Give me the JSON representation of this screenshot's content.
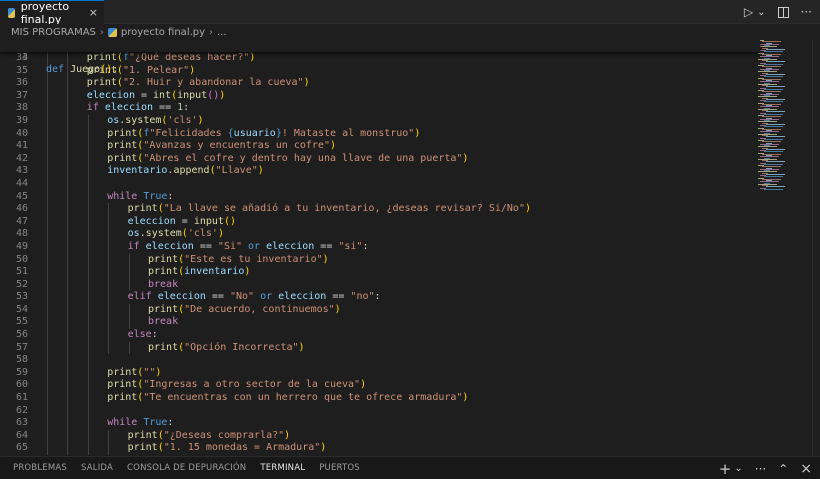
{
  "tab": {
    "title": "proyecto final.py",
    "close": "×"
  },
  "tab_actions": {
    "run": "▷",
    "run_menu": "⌄",
    "more": "···"
  },
  "breadcrumb": {
    "folder": "MIS PROGRAMAS",
    "sep1": "›",
    "file": "proyecto final.py",
    "sep2": "›",
    "rest": "..."
  },
  "sticky": {
    "number": "3",
    "code": [
      [
        "kb",
        "def "
      ],
      [
        "fn",
        "Juego"
      ],
      [
        "br1",
        "():"
      ]
    ]
  },
  "lines": [
    {
      "n": "34",
      "indent": 2,
      "code": [
        [
          "fn",
          "print"
        ],
        [
          "br1",
          "("
        ],
        [
          "kb",
          "f"
        ],
        [
          "st",
          "\"¿Qué deseas hacer?\""
        ],
        [
          "br1",
          ")"
        ]
      ]
    },
    {
      "n": "35",
      "indent": 2,
      "code": [
        [
          "fn",
          "print"
        ],
        [
          "br1",
          "("
        ],
        [
          "st",
          "\"1. Pelear\""
        ],
        [
          "br1",
          ")"
        ]
      ]
    },
    {
      "n": "36",
      "indent": 2,
      "code": [
        [
          "fn",
          "print"
        ],
        [
          "br1",
          "("
        ],
        [
          "st",
          "\"2. Huir y abandonar la cueva\""
        ],
        [
          "br1",
          ")"
        ]
      ]
    },
    {
      "n": "37",
      "indent": 2,
      "code": [
        [
          "vr",
          "eleccion"
        ],
        [
          "tx",
          " = "
        ],
        [
          "fn",
          "int"
        ],
        [
          "br1",
          "("
        ],
        [
          "fn",
          "input"
        ],
        [
          "br2",
          "()"
        ],
        [
          "br1",
          ")"
        ]
      ]
    },
    {
      "n": "38",
      "indent": 2,
      "code": [
        [
          "kw",
          "if "
        ],
        [
          "vr",
          "eleccion"
        ],
        [
          "tx",
          " == "
        ],
        [
          "nm",
          "1"
        ],
        [
          "tx",
          ":"
        ]
      ]
    },
    {
      "n": "39",
      "indent": 3,
      "code": [
        [
          "vr",
          "os"
        ],
        [
          "tx",
          "."
        ],
        [
          "fn",
          "system"
        ],
        [
          "br1",
          "("
        ],
        [
          "st",
          "'cls'"
        ],
        [
          "br1",
          ")"
        ]
      ]
    },
    {
      "n": "40",
      "indent": 3,
      "code": [
        [
          "fn",
          "print"
        ],
        [
          "br1",
          "("
        ],
        [
          "kb",
          "f"
        ],
        [
          "st",
          "\"Felicidades "
        ],
        [
          "kb",
          "{"
        ],
        [
          "vr",
          "usuario"
        ],
        [
          "kb",
          "}"
        ],
        [
          "st",
          "! Mataste al monstruo\""
        ],
        [
          "br1",
          ")"
        ]
      ]
    },
    {
      "n": "41",
      "indent": 3,
      "code": [
        [
          "fn",
          "print"
        ],
        [
          "br1",
          "("
        ],
        [
          "st",
          "\"Avanzas y encuentras un cofre\""
        ],
        [
          "br1",
          ")"
        ]
      ]
    },
    {
      "n": "42",
      "indent": 3,
      "code": [
        [
          "fn",
          "print"
        ],
        [
          "br1",
          "("
        ],
        [
          "st",
          "\"Abres el cofre y dentro hay una llave de una puerta\""
        ],
        [
          "br1",
          ")"
        ]
      ]
    },
    {
      "n": "43",
      "indent": 3,
      "code": [
        [
          "vr",
          "inventario"
        ],
        [
          "tx",
          "."
        ],
        [
          "fn",
          "append"
        ],
        [
          "br1",
          "("
        ],
        [
          "st",
          "\"Llave\""
        ],
        [
          "br1",
          ")"
        ]
      ]
    },
    {
      "n": "44",
      "indent": 3,
      "code": []
    },
    {
      "n": "45",
      "indent": 3,
      "code": [
        [
          "kw",
          "while "
        ],
        [
          "kb",
          "True"
        ],
        [
          "tx",
          ":"
        ]
      ]
    },
    {
      "n": "46",
      "indent": 4,
      "code": [
        [
          "fn",
          "print"
        ],
        [
          "br1",
          "("
        ],
        [
          "st",
          "\"La llave se añadió a tu inventario, ¿deseas revisar? Si/No\""
        ],
        [
          "br1",
          ")"
        ]
      ]
    },
    {
      "n": "47",
      "indent": 4,
      "code": [
        [
          "vr",
          "eleccion"
        ],
        [
          "tx",
          " = "
        ],
        [
          "fn",
          "input"
        ],
        [
          "br1",
          "()"
        ]
      ]
    },
    {
      "n": "48",
      "indent": 4,
      "code": [
        [
          "vr",
          "os"
        ],
        [
          "tx",
          "."
        ],
        [
          "fn",
          "system"
        ],
        [
          "br1",
          "("
        ],
        [
          "st",
          "'cls'"
        ],
        [
          "br1",
          ")"
        ]
      ]
    },
    {
      "n": "49",
      "indent": 4,
      "code": [
        [
          "kw",
          "if "
        ],
        [
          "vr",
          "eleccion"
        ],
        [
          "tx",
          " == "
        ],
        [
          "st",
          "\"Si\""
        ],
        [
          "kb",
          " or "
        ],
        [
          "vr",
          "eleccion"
        ],
        [
          "tx",
          " == "
        ],
        [
          "st",
          "\"si\""
        ],
        [
          "tx",
          ":"
        ]
      ]
    },
    {
      "n": "50",
      "indent": 5,
      "code": [
        [
          "fn",
          "print"
        ],
        [
          "br1",
          "("
        ],
        [
          "st",
          "\"Este es tu inventario\""
        ],
        [
          "br1",
          ")"
        ]
      ]
    },
    {
      "n": "51",
      "indent": 5,
      "code": [
        [
          "fn",
          "print"
        ],
        [
          "br1",
          "("
        ],
        [
          "vr",
          "inventario"
        ],
        [
          "br1",
          ")"
        ]
      ]
    },
    {
      "n": "52",
      "indent": 5,
      "code": [
        [
          "kw",
          "break"
        ]
      ]
    },
    {
      "n": "53",
      "indent": 4,
      "code": [
        [
          "kw",
          "elif "
        ],
        [
          "vr",
          "eleccion"
        ],
        [
          "tx",
          " == "
        ],
        [
          "st",
          "\"No\""
        ],
        [
          "kb",
          " or "
        ],
        [
          "vr",
          "eleccion"
        ],
        [
          "tx",
          " == "
        ],
        [
          "st",
          "\"no\""
        ],
        [
          "tx",
          ":"
        ]
      ]
    },
    {
      "n": "54",
      "indent": 5,
      "code": [
        [
          "fn",
          "print"
        ],
        [
          "br1",
          "("
        ],
        [
          "st",
          "\"De acuerdo, continuemos\""
        ],
        [
          "br1",
          ")"
        ]
      ]
    },
    {
      "n": "55",
      "indent": 5,
      "code": [
        [
          "kw",
          "break"
        ]
      ]
    },
    {
      "n": "56",
      "indent": 4,
      "code": [
        [
          "kw",
          "else"
        ],
        [
          "tx",
          ":"
        ]
      ]
    },
    {
      "n": "57",
      "indent": 5,
      "code": [
        [
          "fn",
          "print"
        ],
        [
          "br1",
          "("
        ],
        [
          "st",
          "\"Opción Incorrecta\""
        ],
        [
          "br1",
          ")"
        ]
      ]
    },
    {
      "n": "58",
      "indent": 3,
      "code": []
    },
    {
      "n": "59",
      "indent": 3,
      "code": [
        [
          "fn",
          "print"
        ],
        [
          "br1",
          "("
        ],
        [
          "st",
          "\"\""
        ],
        [
          "br1",
          ")"
        ]
      ]
    },
    {
      "n": "60",
      "indent": 3,
      "code": [
        [
          "fn",
          "print"
        ],
        [
          "br1",
          "("
        ],
        [
          "st",
          "\"Ingresas a otro sector de la cueva\""
        ],
        [
          "br1",
          ")"
        ]
      ]
    },
    {
      "n": "61",
      "indent": 3,
      "code": [
        [
          "fn",
          "print"
        ],
        [
          "br1",
          "("
        ],
        [
          "st",
          "\"Te encuentras con un herrero que te ofrece armadura\""
        ],
        [
          "br1",
          ")"
        ]
      ]
    },
    {
      "n": "62",
      "indent": 3,
      "code": []
    },
    {
      "n": "63",
      "indent": 3,
      "code": [
        [
          "kw",
          "while "
        ],
        [
          "kb",
          "True"
        ],
        [
          "tx",
          ":"
        ]
      ]
    },
    {
      "n": "64",
      "indent": 4,
      "code": [
        [
          "fn",
          "print"
        ],
        [
          "br1",
          "("
        ],
        [
          "st",
          "\"¿Deseas comprarla?\""
        ],
        [
          "br1",
          ")"
        ]
      ]
    },
    {
      "n": "65",
      "indent": 4,
      "code": [
        [
          "fn",
          "print"
        ],
        [
          "br1",
          "("
        ],
        [
          "st",
          "\"1. 15 monedas = Armadura\""
        ],
        [
          "br1",
          ")"
        ]
      ]
    }
  ],
  "panel": {
    "tabs": [
      "PROBLEMAS",
      "SALIDA",
      "CONSOLA DE DEPURACIÓN",
      "TERMINAL",
      "PUERTOS"
    ],
    "active_index": 3,
    "actions": {
      "add": "+",
      "add_menu": "⌄",
      "more": "···",
      "maximize": "⌃",
      "close": "×"
    }
  },
  "colors": {
    "keyword": "#c586c0",
    "builtin_keyword": "#569cd6",
    "function": "#dcdcaa",
    "string": "#ce9178",
    "number": "#b5cea8",
    "variable": "#9cdcfe",
    "bracket1": "#ffd700",
    "bracket2": "#da70d6",
    "accent": "#0078d4"
  }
}
